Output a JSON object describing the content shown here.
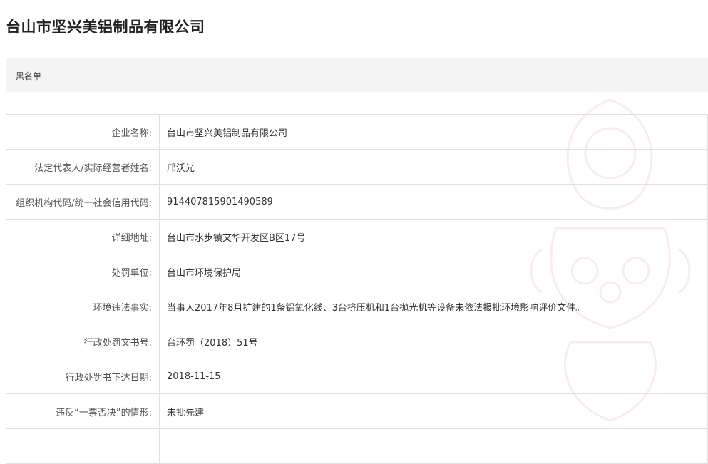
{
  "page": {
    "title": "台山市坚兴美铝制品有限公司"
  },
  "section": {
    "label": "黑名单"
  },
  "details": [
    {
      "label": "企业名称:",
      "value": "台山市坚兴美铝制品有限公司"
    },
    {
      "label": "法定代表人/实际经营者姓名:",
      "value": "邝沃光"
    },
    {
      "label": "组织机构代码/统一社会信用代码:",
      "value": "914407815901490589"
    },
    {
      "label": "详细地址:",
      "value": "台山市水步镇文华开发区B区17号"
    },
    {
      "label": "处罚单位:",
      "value": "台山市环境保护局"
    },
    {
      "label": "环境违法事实:",
      "value": "当事人2017年8月扩建的1条铝氧化线、3台挤压机和1台抛光机等设备未依法报批环境影响评价文件。"
    },
    {
      "label": "行政处罚文书号:",
      "value": "台环罚（2018）51号"
    },
    {
      "label": "行政处罚书下达日期:",
      "value": "2018-11-15"
    },
    {
      "label": "违反“一票否决”的情形:",
      "value": "未批先建"
    },
    {
      "label": "",
      "value": ""
    }
  ],
  "colors": {
    "section_bg": "#f4f4f4",
    "border": "#e0e0e0",
    "watermark": "#c0392b"
  }
}
